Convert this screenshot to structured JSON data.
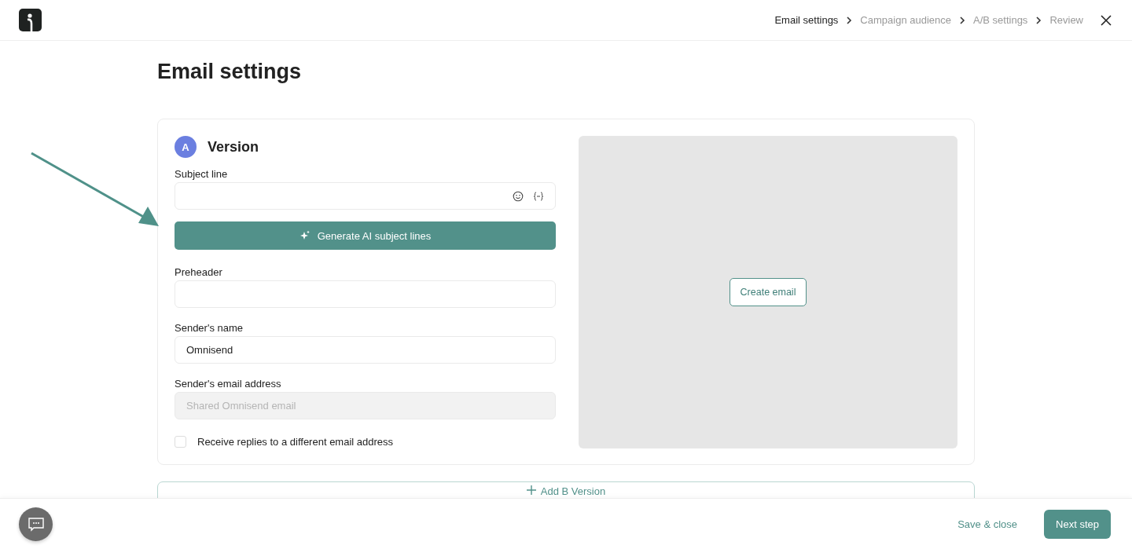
{
  "steps": [
    {
      "label": "Email settings",
      "selected": true
    },
    {
      "label": "Campaign audience",
      "selected": false
    },
    {
      "label": "A/B settings",
      "selected": false
    },
    {
      "label": "Review",
      "selected": false
    }
  ],
  "page_title": "Email settings",
  "version": {
    "badge": "A",
    "title": "Version",
    "fields": [
      {
        "kind": "input",
        "label": "Subject line",
        "tools": true,
        "disabled": false
      },
      {
        "kind": "button",
        "label": "Generate AI subject lines"
      },
      {
        "kind": "input",
        "label": "Preheader",
        "disabled": false
      },
      {
        "kind": "input",
        "label": "Sender's name",
        "value": "Omnisend",
        "disabled": false
      },
      {
        "kind": "input",
        "label": "Sender's email address",
        "placeholder": "Shared Omnisend email",
        "disabled": true
      },
      {
        "kind": "checkbox",
        "label": "Receive replies to a different email address",
        "checked": false
      }
    ],
    "preview_button": "Create email"
  },
  "add_version": "Add B Version",
  "footer": {
    "save": "Save & close",
    "next": "Next step"
  }
}
